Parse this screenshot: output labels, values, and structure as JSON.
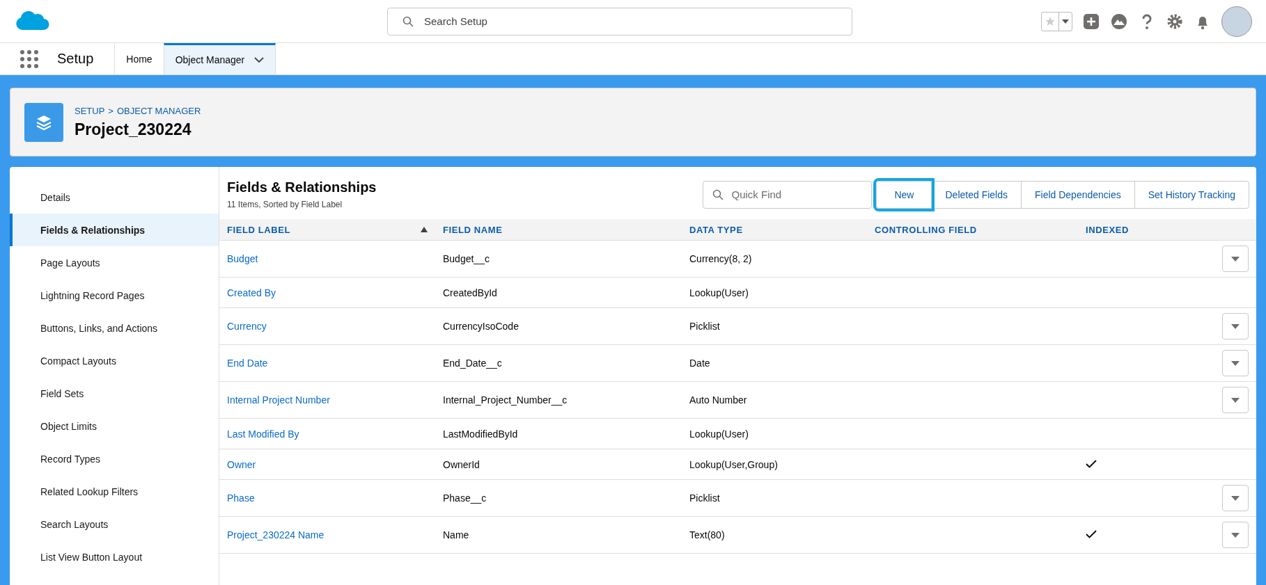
{
  "top_bar": {
    "search": {
      "placeholder": "Search Setup"
    }
  },
  "nav": {
    "app_name": "Setup",
    "tabs": [
      {
        "label": "Home",
        "selected": false,
        "has_menu": false
      },
      {
        "label": "Object Manager",
        "selected": true,
        "has_menu": true
      }
    ]
  },
  "header": {
    "breadcrumbs": [
      "SETUP",
      "OBJECT MANAGER"
    ],
    "separator": ">",
    "title": "Project_230224"
  },
  "sidebar": {
    "items": [
      {
        "label": "Details",
        "selected": false
      },
      {
        "label": "Fields & Relationships",
        "selected": true
      },
      {
        "label": "Page Layouts",
        "selected": false
      },
      {
        "label": "Lightning Record Pages",
        "selected": false
      },
      {
        "label": "Buttons, Links, and Actions",
        "selected": false
      },
      {
        "label": "Compact Layouts",
        "selected": false
      },
      {
        "label": "Field Sets",
        "selected": false
      },
      {
        "label": "Object Limits",
        "selected": false
      },
      {
        "label": "Record Types",
        "selected": false
      },
      {
        "label": "Related Lookup Filters",
        "selected": false
      },
      {
        "label": "Search Layouts",
        "selected": false
      },
      {
        "label": "List View Button Layout",
        "selected": false
      }
    ]
  },
  "panel": {
    "title": "Fields & Relationships",
    "subtitle": "11 Items, Sorted by Field Label",
    "quick_find": {
      "placeholder": "Quick Find"
    },
    "buttons": [
      {
        "label": "New",
        "highlighted": true
      },
      {
        "label": "Deleted Fields",
        "highlighted": false
      },
      {
        "label": "Field Dependencies",
        "highlighted": false
      },
      {
        "label": "Set History Tracking",
        "highlighted": false
      }
    ]
  },
  "table": {
    "columns": [
      {
        "label": "FIELD LABEL",
        "sorted": true
      },
      {
        "label": "FIELD NAME",
        "sorted": false
      },
      {
        "label": "DATA TYPE",
        "sorted": false
      },
      {
        "label": "CONTROLLING FIELD",
        "sorted": false
      },
      {
        "label": "INDEXED",
        "sorted": false
      }
    ],
    "rows": [
      {
        "field_label": "Budget",
        "field_name": "Budget__c",
        "data_type": "Currency(8, 2)",
        "indexed": false,
        "has_menu": true
      },
      {
        "field_label": "Created By",
        "field_name": "CreatedById",
        "data_type": "Lookup(User)",
        "indexed": false,
        "has_menu": false
      },
      {
        "field_label": "Currency",
        "field_name": "CurrencyIsoCode",
        "data_type": "Picklist",
        "indexed": false,
        "has_menu": true
      },
      {
        "field_label": "End Date",
        "field_name": "End_Date__c",
        "data_type": "Date",
        "indexed": false,
        "has_menu": true
      },
      {
        "field_label": "Internal Project Number",
        "field_name": "Internal_Project_Number__c",
        "data_type": "Auto Number",
        "indexed": false,
        "has_menu": true
      },
      {
        "field_label": "Last Modified By",
        "field_name": "LastModifiedById",
        "data_type": "Lookup(User)",
        "indexed": false,
        "has_menu": false
      },
      {
        "field_label": "Owner",
        "field_name": "OwnerId",
        "data_type": "Lookup(User,Group)",
        "indexed": true,
        "has_menu": false
      },
      {
        "field_label": "Phase",
        "field_name": "Phase__c",
        "data_type": "Picklist",
        "indexed": false,
        "has_menu": true
      },
      {
        "field_label": "Project_230224 Name",
        "field_name": "Name",
        "data_type": "Text(80)",
        "indexed": true,
        "has_menu": true
      }
    ]
  }
}
